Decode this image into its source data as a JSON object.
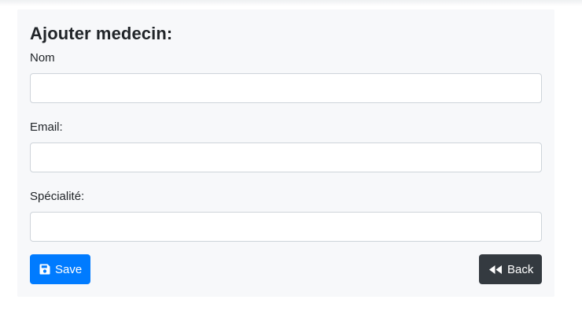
{
  "form": {
    "title": "Ajouter medecin:",
    "fields": [
      {
        "label": "Nom",
        "value": "",
        "placeholder": ""
      },
      {
        "label": "Email:",
        "value": "",
        "placeholder": ""
      },
      {
        "label": "Spécialité:",
        "value": "",
        "placeholder": ""
      }
    ],
    "save_label": "Save",
    "back_label": "Back"
  },
  "colors": {
    "save_button": "#007bff",
    "back_button": "#343a40",
    "card_background": "#f7f8fa"
  },
  "icons": {
    "save": "floppy-disk-icon",
    "back": "backward-icon"
  }
}
